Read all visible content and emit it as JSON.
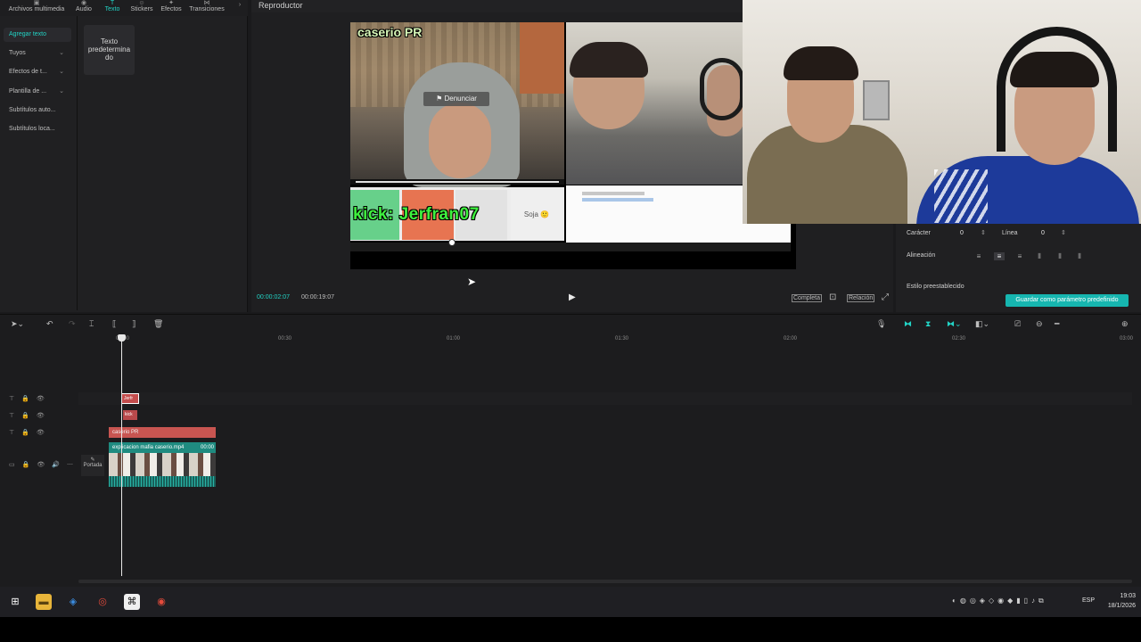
{
  "toolbar": {
    "items": [
      {
        "label": "Archivos multimedia",
        "icon": "media-icon"
      },
      {
        "label": "Audio",
        "icon": "audio-icon"
      },
      {
        "label": "Texto",
        "icon": "text-icon",
        "active": true
      },
      {
        "label": "Stickers",
        "icon": "sticker-icon"
      },
      {
        "label": "Efectos",
        "icon": "effects-icon"
      },
      {
        "label": "Transiciones",
        "icon": "transition-icon"
      }
    ]
  },
  "left_nav": {
    "items": [
      {
        "label": "Agregar texto",
        "active": true
      },
      {
        "label": "Tuyos"
      },
      {
        "label": "Efectos de t..."
      },
      {
        "label": "Plantilla de ..."
      },
      {
        "label": "Subtítulos auto..."
      },
      {
        "label": "Subtítulos loca..."
      }
    ],
    "preset_card": "Texto predetermina do"
  },
  "player": {
    "title": "Reproductor",
    "time_current": "00:00:02:07",
    "time_total": "00:00:19:07",
    "btn_completa": "Completa",
    "btn_relacion": "Relación"
  },
  "video": {
    "overlay_label": "caserio PR",
    "report_button": "Denunciar",
    "kick_text": "kick: Jerfran07",
    "chat_soja": "Soja"
  },
  "props": {
    "caracter_label": "Carácter",
    "caracter_value": "0",
    "linea_label": "Línea",
    "linea_value": "0",
    "alineacion_label": "Alineación",
    "estilo_label": "Estilo preestablecido",
    "save_preset_button": "Guardar como parámetro predefinido"
  },
  "timeline": {
    "ticks": [
      "00:00",
      "00:30",
      "01:00",
      "01:30",
      "02:00",
      "02:30",
      "03:00"
    ],
    "clips": {
      "jerfran": "Jerfr",
      "kick": "kick",
      "caserio": "caserio PR",
      "video_name": "explicacion mafia caserio.mp4",
      "video_duration": "00:00"
    },
    "cover_label": "Portada"
  },
  "taskbar": {
    "lang": "ESP",
    "time": "19:03",
    "date": "18/1/2026"
  },
  "colors": {
    "accent": "#22d3c5",
    "clip_text": "#c85551",
    "clip_video": "#1f8b80",
    "save_button": "#16b6b0"
  }
}
